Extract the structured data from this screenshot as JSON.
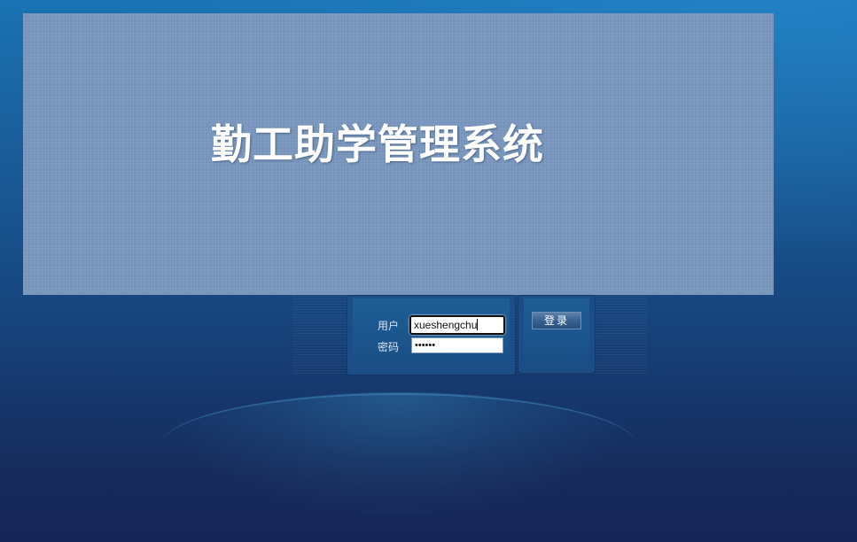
{
  "banner": {
    "title": "勤工助学管理系统"
  },
  "login": {
    "username_label": "用户",
    "username_value": "xueshengchu",
    "password_label": "密码",
    "password_masked": "••••••",
    "login_button": "登录"
  },
  "colors": {
    "banner_bg": "#7896bd",
    "page_bg_top": "#1a73b3",
    "page_bg_bottom": "#162556",
    "panel_bg": "#1c4d86"
  }
}
